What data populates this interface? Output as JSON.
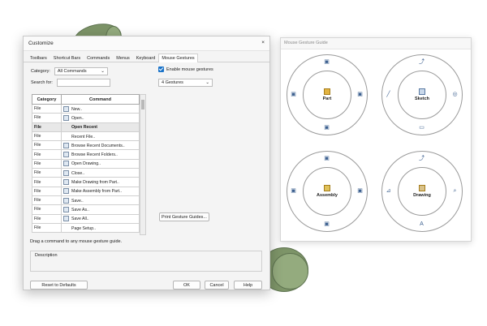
{
  "dialog": {
    "title": "Customize",
    "close_glyph": "×",
    "tabs": [
      "Toolbars",
      "Shortcut Bars",
      "Commands",
      "Menus",
      "Keyboard",
      "Mouse Gestures"
    ],
    "active_tab": "Mouse Gestures",
    "category_label": "Category:",
    "category_value": "All Commands",
    "search_label": "Search for:",
    "search_value": "",
    "enable_checkbox_label": "Enable mouse gestures",
    "enable_checked": true,
    "gestures_value": "4 Gestures",
    "table": {
      "headers": [
        "Category",
        "Command"
      ],
      "rows": [
        {
          "category": "File",
          "command": "New..",
          "icon": "new-file-icon"
        },
        {
          "category": "File",
          "command": "Open..",
          "icon": "open-file-icon"
        },
        {
          "category": "File",
          "command": "Open Recent",
          "icon": "",
          "selected": true
        },
        {
          "category": "File",
          "command": "Recent File..",
          "icon": ""
        },
        {
          "category": "File",
          "command": "Browse Recent Documents..",
          "icon": "browse-documents-icon"
        },
        {
          "category": "File",
          "command": "Browse Recent Folders..",
          "icon": "browse-folders-icon"
        },
        {
          "category": "File",
          "command": "Open Drawing..",
          "icon": "open-drawing-icon"
        },
        {
          "category": "File",
          "command": "Close..",
          "icon": "close-doc-icon"
        },
        {
          "category": "File",
          "command": "Make Drawing from Part..",
          "icon": "make-drawing-icon"
        },
        {
          "category": "File",
          "command": "Make Assembly from Part..",
          "icon": "make-assembly-icon"
        },
        {
          "category": "File",
          "command": "Save..",
          "icon": "save-icon"
        },
        {
          "category": "File",
          "command": "Save As..",
          "icon": "save-as-icon"
        },
        {
          "category": "File",
          "command": "Save All..",
          "icon": "save-all-icon"
        },
        {
          "category": "File",
          "command": "Page Setup..",
          "icon": ""
        }
      ]
    },
    "print_button": "Print Gesture Guides...",
    "drag_hint": "Drag a command to any mouse gesture guide.",
    "description_label": "Description",
    "reset_button": "Reset to Defaults",
    "ok_button": "OK",
    "cancel_button": "Cancel",
    "help_button": "Help"
  },
  "guide": {
    "title": "Mouse Gesture Guide",
    "wheels": [
      {
        "label": "Part"
      },
      {
        "label": "Sketch"
      },
      {
        "label": "Assembly"
      },
      {
        "label": "Drawing"
      }
    ]
  },
  "colors": {
    "accent": "#1a73c9",
    "shape_green": "#7d9468"
  }
}
